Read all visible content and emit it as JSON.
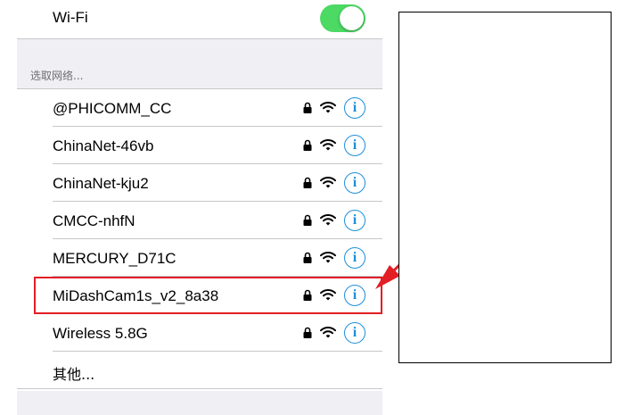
{
  "wifi": {
    "label": "Wi-Fi",
    "enabled": true
  },
  "section_header": "选取网络...",
  "networks": [
    {
      "name": "@PHICOMM_CC",
      "secured": true
    },
    {
      "name": "ChinaNet-46vb",
      "secured": true
    },
    {
      "name": "ChinaNet-kju2",
      "secured": true
    },
    {
      "name": "CMCC-nhfN",
      "secured": true
    },
    {
      "name": "MERCURY_D71C",
      "secured": true
    },
    {
      "name": "MiDashCam1s_v2_8a38",
      "secured": true,
      "highlighted": true
    },
    {
      "name": "Wireless 5.8G",
      "secured": true
    }
  ],
  "other": {
    "label": "其他..."
  },
  "icons": {
    "lock": "lock-icon",
    "signal": "wifi-signal-icon",
    "info": "info-icon"
  },
  "colors": {
    "toggle_on": "#4cd964",
    "info": "#1a8fdc",
    "highlight": "#e31e24"
  }
}
